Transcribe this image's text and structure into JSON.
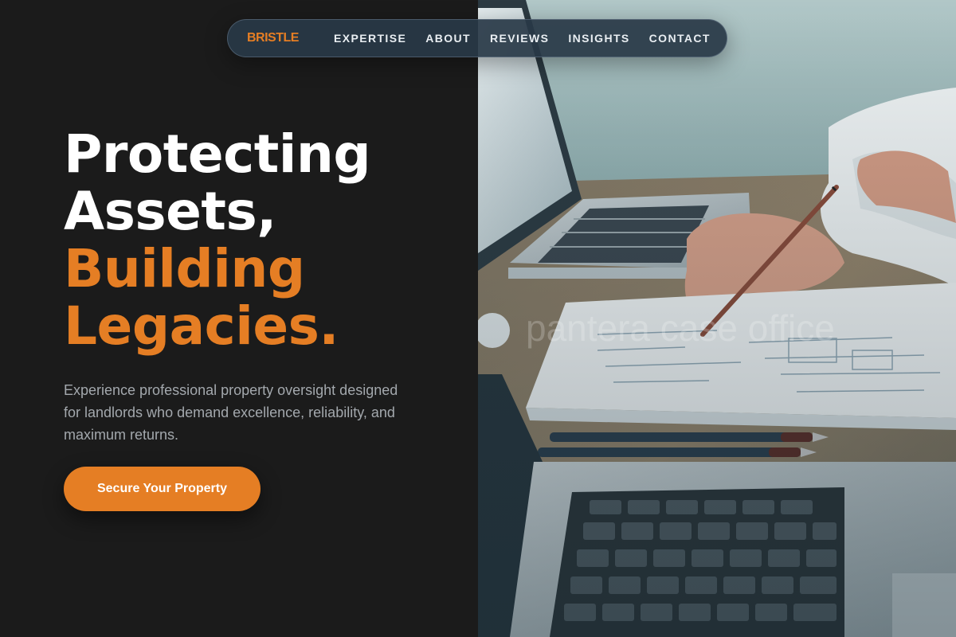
{
  "nav": {
    "brand": "BRISTLE",
    "links": [
      "EXPERTISE",
      "ABOUT",
      "REVIEWS",
      "INSIGHTS",
      "CONTACT"
    ]
  },
  "hero": {
    "headline_line1": "Protecting",
    "headline_line2": "Assets,",
    "headline_line3": "Building",
    "headline_line4": "Legacies.",
    "subtext": "Experience professional property oversight designed for landlords who demand excellence, reliability, and maximum returns.",
    "cta_label": "Secure Your Property"
  },
  "image": {
    "watermark": "pantera case office"
  },
  "colors": {
    "accent": "#e57e24",
    "background": "#1b1b1b",
    "nav_background": "#283846",
    "subtext": "#a3a8ad"
  }
}
